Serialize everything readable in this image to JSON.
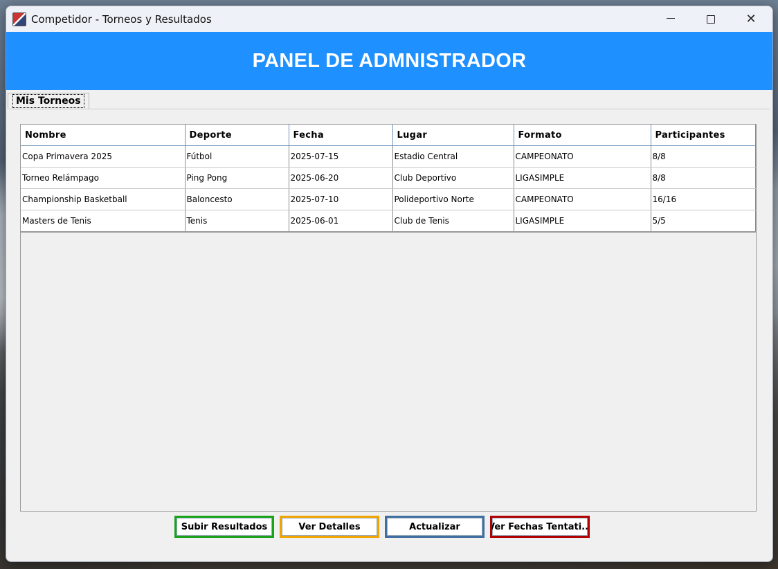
{
  "window": {
    "title": "Competidor - Torneos y Resultados",
    "controls": {
      "minimize": "minimize-icon",
      "maximize": "maximize-icon",
      "close": "✕"
    }
  },
  "banner": {
    "title": "PANEL DE ADMNISTRADOR",
    "color": "#1e90ff"
  },
  "tabs": [
    {
      "label": "Mis Torneos"
    }
  ],
  "table": {
    "columns": [
      "Nombre",
      "Deporte",
      "Fecha",
      "Lugar",
      "Formato",
      "Participantes"
    ],
    "rows": [
      [
        "Copa Primavera 2025",
        "Fútbol",
        "2025-07-15",
        "Estadio Central",
        "CAMPEONATO",
        "8/8"
      ],
      [
        "Torneo Relámpago",
        "Ping Pong",
        "2025-06-20",
        "Club Deportivo",
        "LIGASIMPLE",
        "8/8"
      ],
      [
        "Championship Basketball",
        "Baloncesto",
        "2025-07-10",
        "Polideportivo Norte",
        "CAMPEONATO",
        "16/16"
      ],
      [
        "Masters de Tenis",
        "Tenis",
        "2025-06-01",
        "Club de Tenis",
        "LIGASIMPLE",
        "5/5"
      ]
    ]
  },
  "buttons": [
    {
      "label": "Subir Resultados",
      "border_color": "#1aa31a"
    },
    {
      "label": "Ver Detalles",
      "border_color": "#f0a500"
    },
    {
      "label": "Actualizar",
      "border_color": "#3f6fa0"
    },
    {
      "label": "Ver Fechas Tentati...",
      "border_color": "#b00000"
    }
  ]
}
